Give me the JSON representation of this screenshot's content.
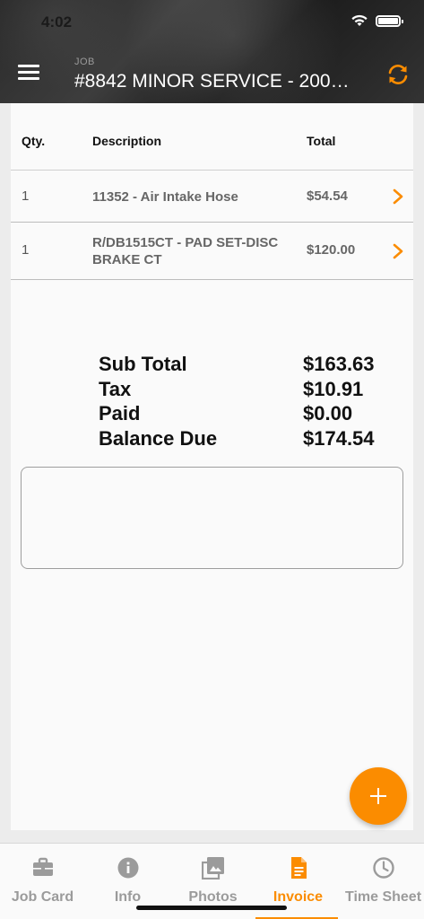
{
  "status_bar": {
    "time": "4:02"
  },
  "header": {
    "label": "JOB",
    "title": "#8842 MINOR SERVICE - 200…",
    "menu_icon": "hamburger-menu-icon",
    "sync_icon": "sync-icon"
  },
  "table": {
    "columns": {
      "qty": "Qty.",
      "description": "Description",
      "total": "Total"
    },
    "rows": [
      {
        "qty": "1",
        "description": "11352 - Air Intake Hose",
        "total": "$54.54"
      },
      {
        "qty": "1",
        "description": "R/DB1515CT - PAD SET-DISC BRAKE CT",
        "total": "$120.00"
      }
    ]
  },
  "totals": {
    "subtotal_label": "Sub Total",
    "subtotal": "$163.63",
    "tax_label": "Tax",
    "tax": "$10.91",
    "paid_label": "Paid",
    "paid": "$0.00",
    "balance_label": "Balance Due",
    "balance": "$174.54"
  },
  "notes": {
    "value": ""
  },
  "fab": {
    "icon": "plus-icon"
  },
  "tabs": [
    {
      "label": "Job Card",
      "icon": "briefcase-icon"
    },
    {
      "label": "Info",
      "icon": "info-icon"
    },
    {
      "label": "Photos",
      "icon": "photos-icon"
    },
    {
      "label": "Invoice",
      "icon": "document-icon",
      "active": true
    },
    {
      "label": "Time Sheet",
      "icon": "clock-icon"
    }
  ],
  "colors": {
    "accent": "#fb8c00",
    "header_bg": "#2a2a2a",
    "inactive": "#9b9b9b"
  }
}
